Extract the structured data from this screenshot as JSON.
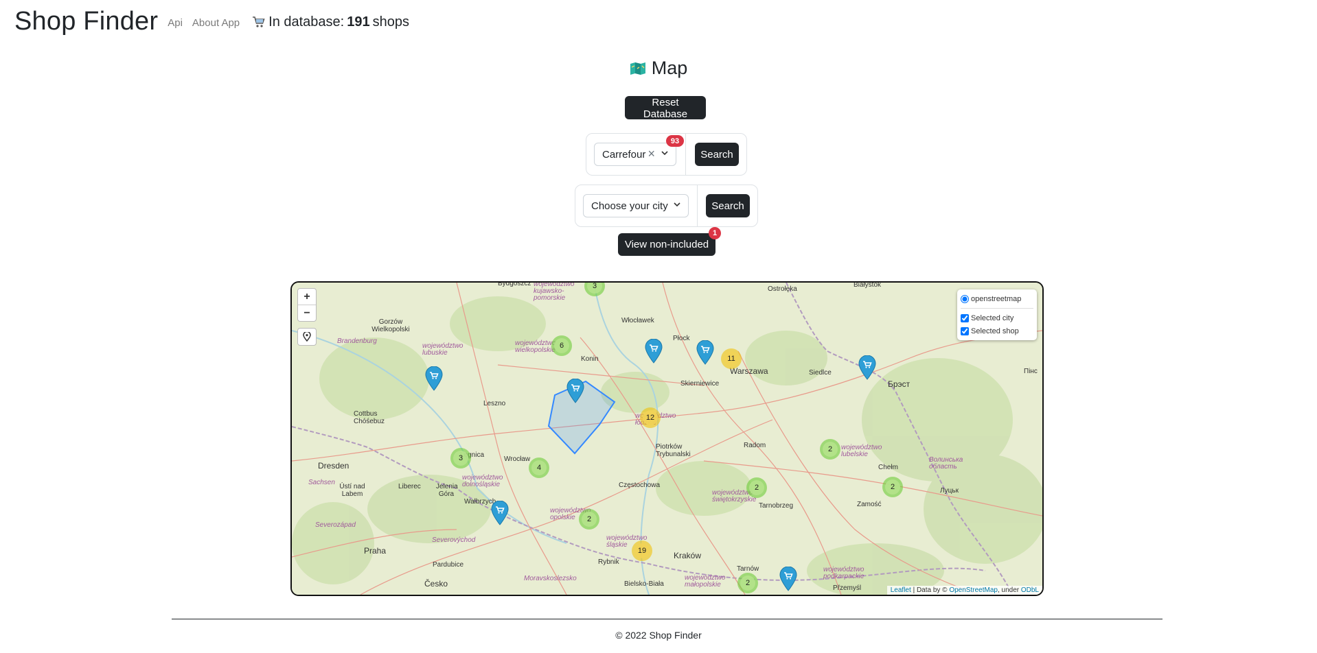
{
  "header": {
    "brand": "Shop Finder",
    "nav": [
      "Api",
      "About App"
    ],
    "db_prefix": "In database:",
    "db_count": "191",
    "db_suffix": "shops",
    "cart_icon": "cart-icon"
  },
  "title": {
    "icon": "map-icon",
    "text": "Map"
  },
  "actions": {
    "reset_label": "Reset Database",
    "view_nonincluded_label": "View non-included",
    "view_nonincluded_badge": "1"
  },
  "shop_filter": {
    "selected": "Carrefour",
    "badge": "93",
    "search_label": "Search"
  },
  "city_filter": {
    "placeholder": "Choose your city",
    "search_label": "Search"
  },
  "map": {
    "zoom_in": "+",
    "zoom_out": "−",
    "layers": {
      "base": "openstreetmap",
      "overlays": [
        "Selected city",
        "Selected shop"
      ]
    },
    "attribution": {
      "leaflet": "Leaflet",
      "data_by": "| Data by ©",
      "osm": "OpenStreetMap",
      "under": ", under",
      "odbl": "ODbL"
    },
    "place_labels": [
      "Bydgoszcz",
      "Ostrołęka",
      "Białystok",
      "Gorzów Wielkopolski",
      "Włocławek",
      "Płock",
      "Brandenburg",
      "Konin",
      "Skierniewice",
      "Warszawa",
      "Siedlce",
      "Брэст",
      "Leszno",
      "Cottbus Chóśebuz",
      "Radom",
      "Piotrków Trybunalski",
      "Legnica",
      "Wrocław",
      "Dresden",
      "Częstochowa",
      "Chełm",
      "Ústí nad Labem",
      "Liberec",
      "Jelenia Góra",
      "Wałbrzych",
      "Tarnobrzeg",
      "Zamość",
      "Луцьк",
      "Praha",
      "Pardubice",
      "Rybnik",
      "Kraków",
      "Tarnów",
      "Bielsko-Biała",
      "Přzemyśl",
      "Česko",
      "Sachsen",
      "Severozápad",
      "Severovýchod",
      "Moravskoslezsko",
      "województwo lubuskie",
      "województwo wielkopolskie",
      "województwo łódzkie",
      "województwo dolnośląskie",
      "województwo opolskie",
      "województwo śląskie",
      "województwo świętokrzyskie",
      "województwo lubelskie",
      "województwo małopolskie",
      "województwo podkarpackie",
      "województwo kujawsko-pomorskie",
      "Волинська область",
      "Пінс"
    ],
    "clusters": [
      {
        "count": "3",
        "color": "green"
      },
      {
        "count": "6",
        "color": "green"
      },
      {
        "count": "11",
        "color": "yellow"
      },
      {
        "count": "12",
        "color": "yellow"
      },
      {
        "count": "3",
        "color": "green"
      },
      {
        "count": "4",
        "color": "green"
      },
      {
        "count": "2",
        "color": "green"
      },
      {
        "count": "2",
        "color": "green"
      },
      {
        "count": "2",
        "color": "green"
      },
      {
        "count": "2",
        "color": "green"
      },
      {
        "count": "19",
        "color": "yellow"
      },
      {
        "count": "2",
        "color": "green"
      }
    ],
    "pin_icon": "shopping-cart-pin-icon"
  },
  "footer": {
    "text": "© 2022 Shop Finder"
  },
  "colors": {
    "dark": "#212529",
    "badge": "#dc3545",
    "pin": "#2e9ed6",
    "polygon": "#3388ff"
  }
}
